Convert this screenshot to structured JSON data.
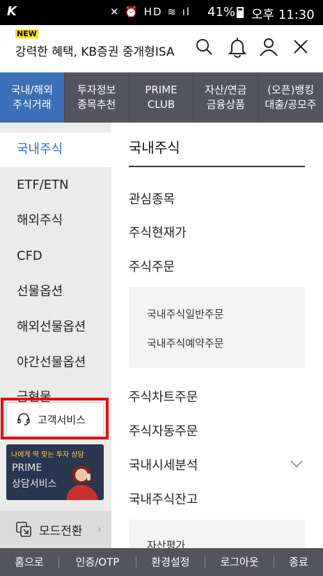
{
  "status_bar": {
    "carrier_logo": "K",
    "status_icons": "✕ ⏰ HD ≋ ıl",
    "battery_percent": "41%",
    "time": "오후 11:30"
  },
  "header": {
    "new_badge": "NEW",
    "promo_text": "강력한 혜택, KB증권 중개형ISA",
    "icons": [
      "search-icon",
      "bell-icon",
      "user-icon",
      "close-icon"
    ]
  },
  "top_tabs": [
    {
      "line1": "국내/해외",
      "line2": "주식거래",
      "active": true
    },
    {
      "line1": "투자정보",
      "line2": "종목추천",
      "active": false
    },
    {
      "line1": "PRIME",
      "line2": "CLUB",
      "active": false
    },
    {
      "line1": "자산/연금",
      "line2": "금융상품",
      "active": false
    },
    {
      "line1": "(오픈)뱅킹",
      "line2": "대출/공모주",
      "active": false
    }
  ],
  "left_nav": {
    "items": [
      "국내주식",
      "ETF/ETN",
      "해외주식",
      "CFD",
      "선물옵션",
      "해외선물옵션",
      "야간선물옵션"
    ],
    "partial_item": "금현물",
    "customer_service": "고객서비스",
    "banner": {
      "caption": "나에게 딱 맞는 투자 상담",
      "line1": "PRIME",
      "line2": "상담서비스"
    },
    "mode_switch": "모드전환"
  },
  "content": {
    "section_title": "국내주식",
    "items_group1": [
      "관심종목",
      "주식현재가",
      "주식주문"
    ],
    "sub_items_1": [
      "국내주식일반주문",
      "국내주식예약주문"
    ],
    "items_group2": [
      "주식차트주문",
      "주식자동주문",
      "국내시세분석",
      "국내주식잔고"
    ],
    "sub_items_2_partial": "자산평가"
  },
  "bottom_bar": [
    "홈으로",
    "인증/OTP",
    "환경설정",
    "로그아웃",
    "종료"
  ],
  "colors": {
    "active_tab": "#3b6fb6",
    "tab_bg": "#53545c",
    "active_text": "#2f6bc0",
    "highlight": "#e30f12",
    "new_badge": "#ffe600"
  }
}
